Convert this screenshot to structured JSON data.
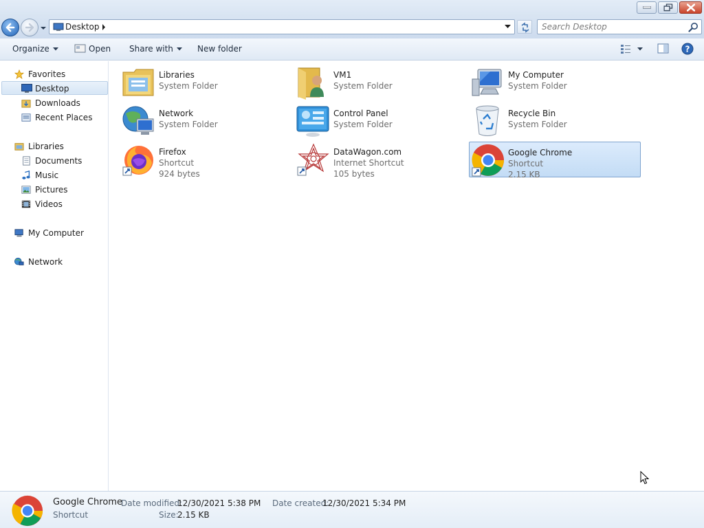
{
  "window": {
    "min_icon": "minimize-icon",
    "max_icon": "restore-icon",
    "close_icon": "close-icon"
  },
  "address": {
    "crumb": "Desktop",
    "icon": "computer-icon"
  },
  "search": {
    "placeholder": "Search Desktop",
    "icon": "search-icon"
  },
  "toolbar": {
    "organize": "Organize",
    "open": "Open",
    "share_with": "Share with",
    "new_folder": "New folder"
  },
  "sidebar": {
    "favorites": {
      "label": "Favorites",
      "items": [
        "Desktop",
        "Downloads",
        "Recent Places"
      ]
    },
    "libraries": {
      "label": "Libraries",
      "items": [
        "Documents",
        "Music",
        "Pictures",
        "Videos"
      ]
    },
    "computer": "My Computer",
    "network": "Network"
  },
  "items": [
    {
      "name": "Libraries",
      "l1": "System Folder",
      "l2": "",
      "icon": "libraries-icon"
    },
    {
      "name": "VM1",
      "l1": "System Folder",
      "l2": "",
      "icon": "user-folder-icon"
    },
    {
      "name": "My Computer",
      "l1": "System Folder",
      "l2": "",
      "icon": "computer-icon"
    },
    {
      "name": "Network",
      "l1": "System Folder",
      "l2": "",
      "icon": "network-icon"
    },
    {
      "name": "Control Panel",
      "l1": "System Folder",
      "l2": "",
      "icon": "control-panel-icon"
    },
    {
      "name": "Recycle Bin",
      "l1": "System Folder",
      "l2": "",
      "icon": "recycle-bin-icon"
    },
    {
      "name": "Firefox",
      "l1": "Shortcut",
      "l2": "924 bytes",
      "icon": "firefox-icon"
    },
    {
      "name": "DataWagon.com",
      "l1": "Internet Shortcut",
      "l2": "105 bytes",
      "icon": "datawagon-icon"
    },
    {
      "name": "Google Chrome",
      "l1": "Shortcut",
      "l2": "2.15 KB",
      "icon": "chrome-icon",
      "selected": true
    }
  ],
  "details": {
    "name": "Google Chrome",
    "type": "Shortcut",
    "modified_label": "Date modified:",
    "modified_value": "12/30/2021 5:38 PM",
    "size_label": "Size:",
    "size_value": "2.15 KB",
    "created_label": "Date created:",
    "created_value": "12/30/2021 5:34 PM"
  },
  "colors": {
    "selection": "#cce4f7",
    "accent": "#2163b8",
    "close": "#c8432a"
  }
}
